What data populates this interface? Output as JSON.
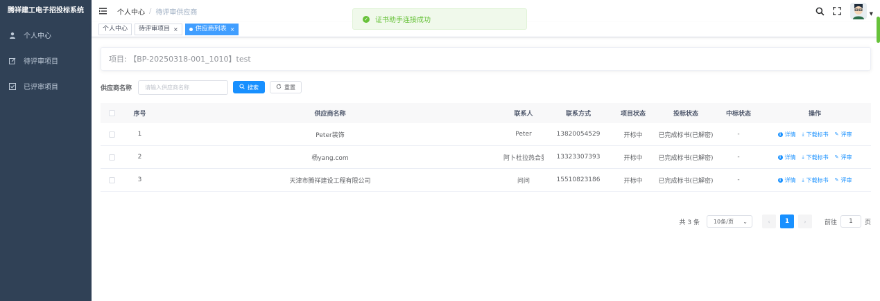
{
  "sidebar": {
    "logo": "腾祥建工电子招投标系统",
    "items": [
      {
        "label": "个人中心",
        "icon": "user-icon"
      },
      {
        "label": "待评审项目",
        "icon": "edit-icon"
      },
      {
        "label": "已评审项目",
        "icon": "checkbox-icon"
      }
    ]
  },
  "navbar": {
    "breadcrumb": [
      "个人中心",
      "待评审供应商"
    ],
    "separator": "/"
  },
  "toast": {
    "message": "证书助手连接成功",
    "type": "success",
    "color": "#67c23a"
  },
  "tags": [
    {
      "label": "个人中心",
      "active": false
    },
    {
      "label": "待评审项目",
      "active": false,
      "closable": true
    },
    {
      "label": "供应商列表",
      "active": true,
      "closable": true
    }
  ],
  "tag_close": "×",
  "project": {
    "label": "项目: 【BP-20250318-001_1010】test"
  },
  "search": {
    "label": "供应商名称",
    "placeholder": "请输入供应商名称",
    "search_button": "搜索",
    "reset_button": "重置"
  },
  "table": {
    "headers": [
      "序号",
      "供应商名称",
      "联系人",
      "联系方式",
      "项目状态",
      "投标状态",
      "中标状态",
      "操作"
    ],
    "rows": [
      {
        "index": "1",
        "name": "Peter装饰",
        "contact": "Peter",
        "phone": "13820054529",
        "project_status": "开标中",
        "bid_status": "已完成标书(已解密)",
        "win_status": "-"
      },
      {
        "index": "2",
        "name": "杨yang.com",
        "contact": "阿卜杜拉热合曼",
        "phone": "13323307393",
        "project_status": "开标中",
        "bid_status": "已完成标书(已解密)",
        "win_status": "-"
      },
      {
        "index": "3",
        "name": "天津市腾祥建设工程有限公司",
        "contact": "问问",
        "phone": "15510823186",
        "project_status": "开标中",
        "bid_status": "已完成标书(已解密)",
        "win_status": "-"
      }
    ],
    "actions": {
      "detail": "详情",
      "download": "下载标书",
      "review": "评审"
    }
  },
  "pagination": {
    "total": "共 3 条",
    "page_size": "10条/页",
    "current_page": "1",
    "goto_label": "前往",
    "goto_value": "1",
    "page_suffix": "页"
  },
  "colors": {
    "primary": "#1890ff",
    "sidebar_bg": "#304156",
    "success": "#67c23a"
  }
}
